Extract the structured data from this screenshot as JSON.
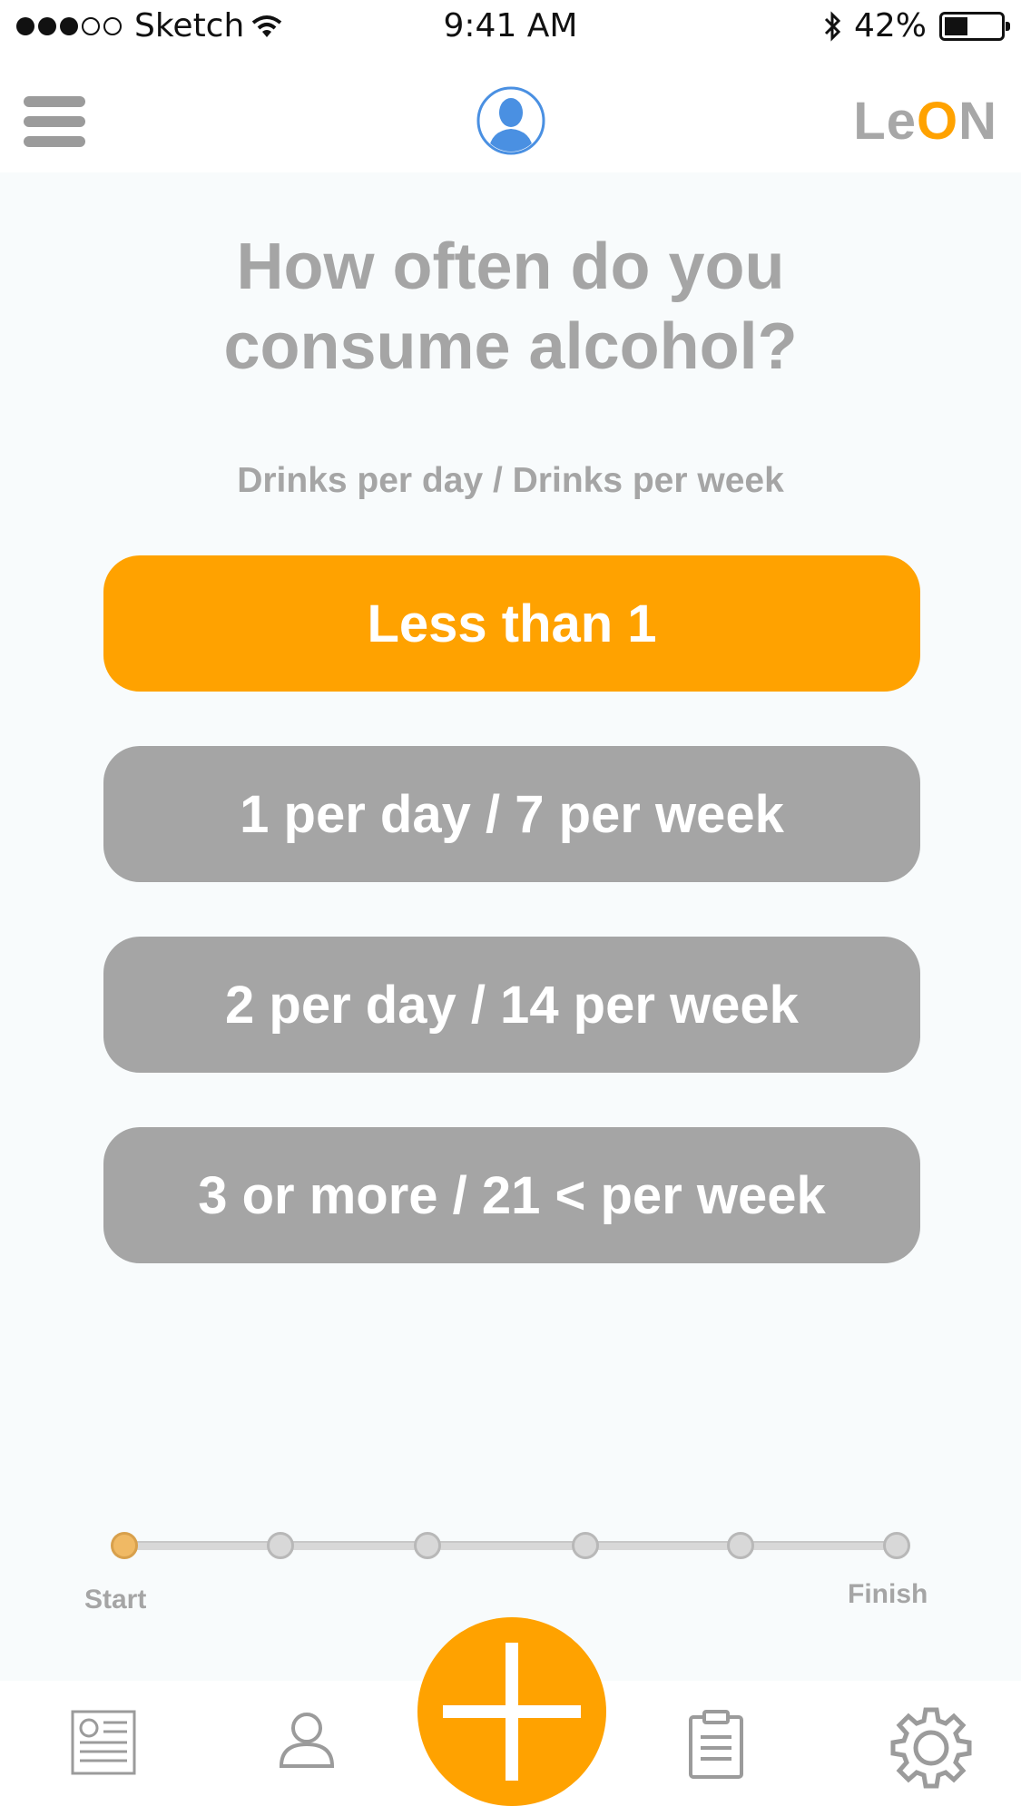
{
  "status_bar": {
    "carrier": "Sketch",
    "time": "9:41 AM",
    "battery": "42%",
    "battery_level": 0.42
  },
  "header": {
    "brand_prefix": "Le",
    "brand_o": "O",
    "brand_suffix": "N",
    "menu_icon": "hamburger-menu-icon",
    "avatar_icon": "user-avatar-icon"
  },
  "question": {
    "line1": "How often do you",
    "line2": "consume alcohol?",
    "subtitle": "Drinks per day / Drinks per week"
  },
  "options": [
    {
      "label": "Less than 1",
      "selected": true
    },
    {
      "label": "1 per day / 7 per week",
      "selected": false
    },
    {
      "label": "2 per day / 14 per week",
      "selected": false
    },
    {
      "label": "3 or more / 21 < per week",
      "selected": false
    }
  ],
  "progress": {
    "start_label": "Start",
    "finish_label": "Finish",
    "steps": 6,
    "current_step": 1
  },
  "tab_bar": {
    "tabs": [
      "news-icon",
      "profile-icon",
      "add-icon",
      "clipboard-icon",
      "settings-gear-icon"
    ]
  },
  "colors": {
    "accent": "#ffa200",
    "button_gray": "#a5a5a5",
    "text_gray": "#a5a5a5",
    "avatar_blue": "#4a90e2",
    "background": "#f8fbfc"
  }
}
